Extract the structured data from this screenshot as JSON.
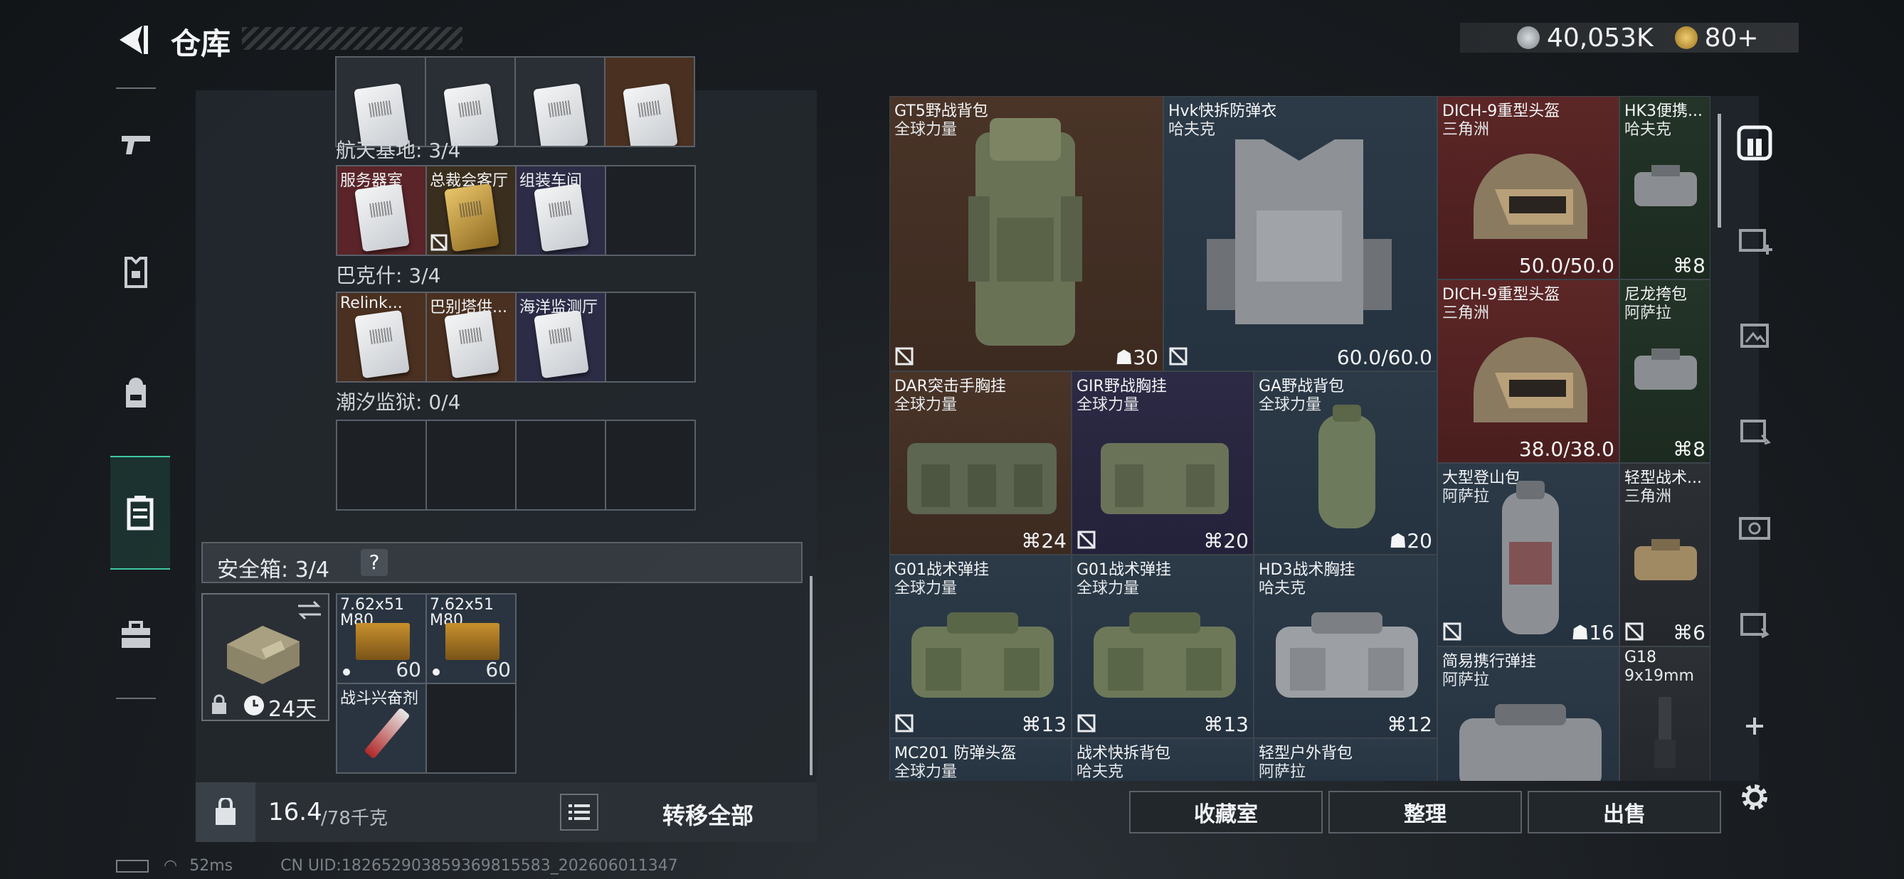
{
  "header": {
    "title": "仓库"
  },
  "currency": {
    "silver": "40,053K",
    "gold": "80+"
  },
  "left_nav": [
    "firearm-icon",
    "armor-icon",
    "backpack-icon",
    "container-icon",
    "toolbox-icon"
  ],
  "keycards": {
    "sections": [
      {
        "label": "航天基地: 3/4",
        "cells": [
          {
            "name": "服务器室",
            "color": "red",
            "locked": false
          },
          {
            "name": "总裁会客厅",
            "color": "gold",
            "locked": true
          },
          {
            "name": "组装车间",
            "color": "purple",
            "locked": false
          },
          {
            "name": "",
            "color": "empty",
            "locked": false
          }
        ]
      },
      {
        "label": "巴克什: 3/4",
        "cells": [
          {
            "name": "Relink...",
            "color": "brown",
            "locked": false
          },
          {
            "name": "巴别塔供...",
            "color": "brown",
            "locked": false
          },
          {
            "name": "海洋监测厅",
            "color": "purple",
            "locked": false
          },
          {
            "name": "",
            "color": "empty",
            "locked": false
          }
        ]
      },
      {
        "label": "潮汐监狱: 0/4",
        "cells": [
          {
            "name": "",
            "color": "empty",
            "locked": false
          },
          {
            "name": "",
            "color": "empty",
            "locked": false
          },
          {
            "name": "",
            "color": "empty",
            "locked": false
          },
          {
            "name": "",
            "color": "empty",
            "locked": false
          }
        ]
      }
    ]
  },
  "safe_box": {
    "label": "安全箱: 3/4",
    "help": "?",
    "timer": "24天",
    "items": [
      {
        "name": "7.62x51",
        "sub": "M80",
        "count": "60"
      },
      {
        "name": "7.62x51",
        "sub": "M80",
        "count": "60"
      },
      {
        "name": "战斗兴奋剂",
        "sub": "",
        "count": ""
      }
    ]
  },
  "bottom_bar": {
    "weight": "16.4",
    "capacity": "/78千克",
    "transfer_all": "转移全部"
  },
  "items": [
    {
      "name": "GT5野战背包",
      "sub": "全球力量",
      "value": "30"
    },
    {
      "name": "Hvk快拆防弹衣",
      "sub": "哈夫克",
      "value": "60.0/60.0"
    },
    {
      "name": "DICH-9重型头盔",
      "sub": "三角洲",
      "value": "50.0/50.0"
    },
    {
      "name": "HK3便携...",
      "sub": "哈夫克",
      "value": "8"
    },
    {
      "name": "DICH-9重型头盔",
      "sub": "三角洲",
      "value": "38.0/38.0"
    },
    {
      "name": "尼龙挎包",
      "sub": "阿萨拉",
      "value": "8"
    },
    {
      "name": "DAR突击手胸挂",
      "sub": "全球力量",
      "value": "24"
    },
    {
      "name": "GIR野战胸挂",
      "sub": "全球力量",
      "value": "20"
    },
    {
      "name": "GA野战背包",
      "sub": "全球力量",
      "value": "20"
    },
    {
      "name": "大型登山包",
      "sub": "阿萨拉",
      "value": "16"
    },
    {
      "name": "轻型战术...",
      "sub": "三角洲",
      "value": "6"
    },
    {
      "name": "G01战术弹挂",
      "sub": "全球力量",
      "value": "13"
    },
    {
      "name": "G01战术弹挂",
      "sub": "全球力量",
      "value": "13"
    },
    {
      "name": "HD3战术胸挂",
      "sub": "哈夫克",
      "value": "12"
    },
    {
      "name": "简易携行弹挂",
      "sub": "阿萨拉",
      "value": ""
    },
    {
      "name": "G18",
      "sub": "9x19mm",
      "value": ""
    },
    {
      "name": "MC201 防弹头盔",
      "sub": "全球力量",
      "value": ""
    },
    {
      "name": "战术快拆背包",
      "sub": "哈夫克",
      "value": ""
    },
    {
      "name": "轻型户外背包",
      "sub": "阿萨拉",
      "value": ""
    }
  ],
  "actions": {
    "collection": "收藏室",
    "sort": "整理",
    "sell": "出售"
  },
  "right_nav": [
    "account-icon",
    "tier4-add-icon",
    "tier3-icon",
    "tier3-arrow-icon",
    "tier5-icon",
    "tier3-swap-icon",
    "plus-icon",
    "settings-icon"
  ],
  "status": {
    "ping": "52ms",
    "uid": "CN UID:182652903859369815583_202606011347"
  }
}
